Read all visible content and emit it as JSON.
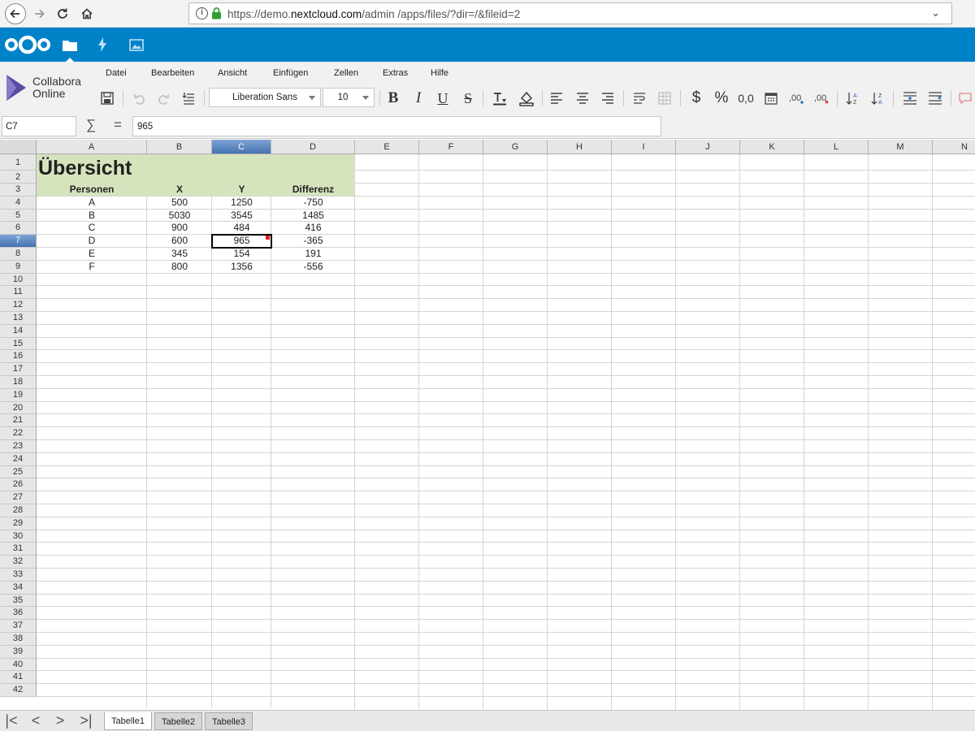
{
  "browser": {
    "url_prefix": "https://demo.",
    "url_domain": "nextcloud.com",
    "url_rest": "/admin /apps/files/?dir=/&fileid=2"
  },
  "nextcloud": {
    "apps": [
      "files-icon",
      "activity-icon",
      "gallery-icon"
    ],
    "accent_color": "#0082c9"
  },
  "office": {
    "brand_line1": "Collabora",
    "brand_line2": "Online",
    "menu": [
      "Datei",
      "Bearbeiten",
      "Ansicht",
      "Einfügen",
      "Zellen",
      "Extras",
      "Hilfe"
    ],
    "font_name": "Liberation Sans",
    "font_size": "10",
    "toolbar": {
      "bold": "B",
      "italic": "I",
      "underline": "U",
      "strike": "S",
      "currency": "$",
      "percent": "%",
      "decimal": "0,0"
    }
  },
  "formula_bar": {
    "cell_ref": "C7",
    "sum_symbol": "∑",
    "equals_symbol": "=",
    "value": "965"
  },
  "sheet": {
    "columns": [
      "A",
      "B",
      "C",
      "D",
      "E",
      "F",
      "G",
      "H",
      "I",
      "J",
      "K",
      "L",
      "M",
      "N"
    ],
    "rows": [
      "1",
      "2",
      "3",
      "4",
      "5",
      "6",
      "7",
      "8",
      "9",
      "10",
      "11",
      "12",
      "13",
      "14",
      "15",
      "16",
      "17",
      "18",
      "19",
      "20",
      "21",
      "22",
      "23",
      "24",
      "25",
      "26",
      "27",
      "28",
      "29",
      "30",
      "31",
      "32",
      "33",
      "34",
      "35",
      "36",
      "37",
      "38",
      "39",
      "40",
      "41",
      "42"
    ],
    "selected_column": "C",
    "selected_row": "7",
    "title": "Übersicht",
    "headers": [
      "Personen",
      "X",
      "Y",
      "Differenz"
    ],
    "data": [
      [
        "A",
        "500",
        "1250",
        "-750"
      ],
      [
        "B",
        "5030",
        "3545",
        "1485"
      ],
      [
        "C",
        "900",
        "484",
        "416"
      ],
      [
        "D",
        "600",
        "965",
        "-365"
      ],
      [
        "E",
        "345",
        "154",
        "191"
      ],
      [
        "F",
        "800",
        "1356",
        "-556"
      ]
    ],
    "highlight_color": "#d5e4bd"
  },
  "tabs": [
    "Tabelle1",
    "Tabelle2",
    "Tabelle3"
  ],
  "active_tab": "Tabelle1"
}
